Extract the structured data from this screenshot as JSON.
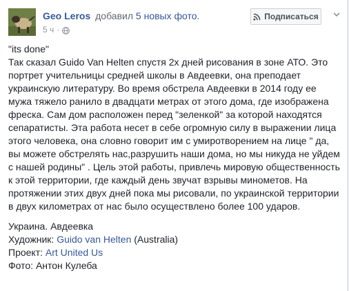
{
  "post": {
    "author": "Geo Leros",
    "action_prefix": "добавил",
    "photos_link": "5 новых фото",
    "action_suffix": ".",
    "time": "5 ч",
    "meta_separator": "·",
    "privacy_icon": "globe-icon",
    "subscribe_label": "Подписаться",
    "subscribe_icon": "rss-icon",
    "options_icon": "chevron-down-icon",
    "quote_line": "\"its done\"",
    "body_paragraph": "Так сказал Guido Van Helten спустя 2х дней рисования в зоне АТО. Это портрет учительницы средней школы в Авдеевки, она преподает украинскую литературу. Во время обстрела Авдеевки в 2014 году ее мужа тяжело ранило в двадцати метрах от этого дома, где изображена фреска. Сам дом расположен перед \"зеленкой\" за которой находятся сепаратисты. Эта работа несет в себе огромную силу в выражении лица этого человека, она словно говорит им с умиротворением на лице \" да, вы можете обстрелять нас,разрушить наши дома, но мы никуда не уйдем с нашей родины\" . Цель этой работы, привлечь мировую общественность к этой территории, где каждый день звучат взрывы минометов. На протяжении этих двух дней пока мы рисовали, по украинской территории в двух километрах от нас было осуществлено более 100 ударов.",
    "location": "Украина. Авдеевка",
    "artist_label": "Художник: ",
    "artist_name": "Guido van Helten",
    "artist_country": " (Australia)",
    "project_label": "Проект: ",
    "project_name": "Art United Us",
    "photo_credit": "Фото: Антон Кулеба"
  },
  "colors": {
    "link": "#365899",
    "text": "#1d2129",
    "meta": "#90949c",
    "background": "#e9ebee"
  }
}
